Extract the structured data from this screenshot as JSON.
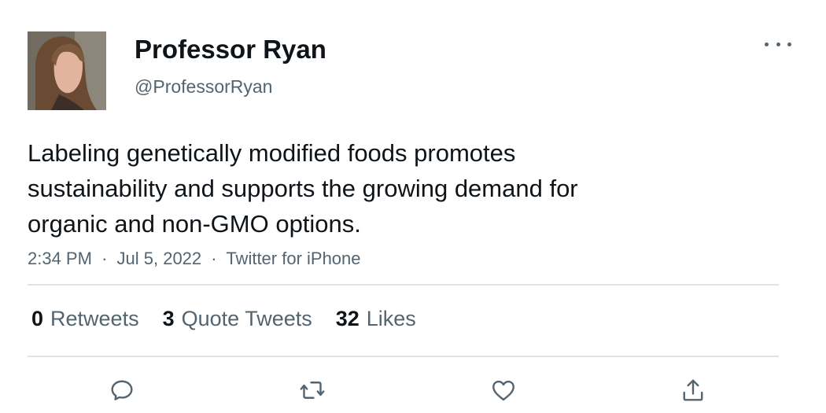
{
  "author": {
    "name": "Professor Ryan",
    "handle": "@ProfessorRyan",
    "avatar_icon": "profile-photo"
  },
  "tweet": {
    "text_lines": [
      "Labeling genetically modified foods promotes",
      "sustainability and supports the growing demand for",
      "organic and non-GMO options."
    ],
    "time": "2:34 PM",
    "date": "Jul 5, 2022",
    "source": "Twitter for iPhone",
    "separator": "·"
  },
  "stats": {
    "retweets": {
      "count": "0",
      "label": "Retweets"
    },
    "quote_tweets": {
      "count": "3",
      "label": "Quote Tweets"
    },
    "likes": {
      "count": "32",
      "label": "Likes"
    }
  },
  "actions": [
    "reply-icon",
    "retweet-icon",
    "like-icon",
    "share-icon"
  ],
  "colors": {
    "primary_text": "#0f1419",
    "secondary_text": "#536471",
    "divider": "#dfe3e6",
    "background": "#ffffff"
  }
}
